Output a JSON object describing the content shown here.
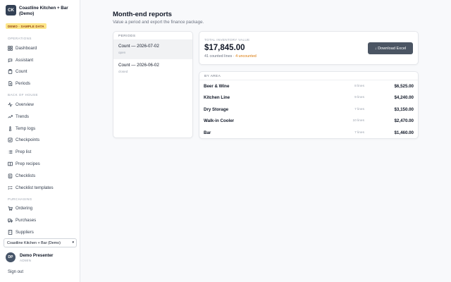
{
  "brand": {
    "logo": "CK",
    "name": "Coastline Kitchen + Bar (Demo)",
    "badge": "DEMO · SAMPLE DATA"
  },
  "nav": {
    "sections": [
      {
        "title": "OPERATIONS",
        "items": [
          {
            "label": "Dashboard",
            "icon": "dashboard-icon"
          },
          {
            "label": "Assistant",
            "icon": "chat-icon"
          },
          {
            "label": "Count",
            "icon": "clipboard-icon"
          },
          {
            "label": "Periods",
            "icon": "document-icon"
          }
        ]
      },
      {
        "title": "BACK OF HOUSE",
        "items": [
          {
            "label": "Overview",
            "icon": "activity-icon"
          },
          {
            "label": "Trends",
            "icon": "trend-icon"
          },
          {
            "label": "Temp logs",
            "icon": "thermometer-icon"
          },
          {
            "label": "Checkpoints",
            "icon": "check-square-icon"
          },
          {
            "label": "Prep list",
            "icon": "list-icon"
          },
          {
            "label": "Prep recipes",
            "icon": "book-icon"
          },
          {
            "label": "Checklists",
            "icon": "checklist-icon"
          },
          {
            "label": "Checklist templates",
            "icon": "template-icon"
          }
        ]
      },
      {
        "title": "PURCHASING",
        "items": [
          {
            "label": "Ordering",
            "icon": "cart-icon"
          },
          {
            "label": "Purchases",
            "icon": "truck-icon"
          },
          {
            "label": "Suppliers",
            "icon": "building-icon"
          }
        ]
      }
    ]
  },
  "org_select": {
    "value": "Coastline Kitchen + Bar (Demo)"
  },
  "user": {
    "initials": "DP",
    "name": "Demo Presenter",
    "role": "ADMIN"
  },
  "signout_label": "Sign out",
  "page": {
    "title": "Month-end reports",
    "subtitle": "Value a period and export the finance package."
  },
  "periods": {
    "header": "PERIODS",
    "items": [
      {
        "name": "Count — 2026-07-02",
        "status": "open",
        "active": true
      },
      {
        "name": "Count — 2026-06-02",
        "status": "closed",
        "active": false
      }
    ]
  },
  "summary": {
    "label": "TOTAL INVENTORY VALUE",
    "value": "$17,845.00",
    "counted": "41 counted lines",
    "separator": " · ",
    "uncounted": "4 uncounted",
    "download_label": "↓ Download Excel"
  },
  "areas": {
    "header": "BY AREA",
    "rows": [
      {
        "name": "Beer & Wine",
        "lines": "8 lines",
        "value": "$6,525.00"
      },
      {
        "name": "Kitchen Line",
        "lines": "9 lines",
        "value": "$4,240.00"
      },
      {
        "name": "Dry Storage",
        "lines": "7 lines",
        "value": "$3,150.00"
      },
      {
        "name": "Walk-in Cooler",
        "lines": "10 lines",
        "value": "$2,470.00"
      },
      {
        "name": "Bar",
        "lines": "7 lines",
        "value": "$1,460.00"
      }
    ]
  },
  "colors": {
    "accent": "#4b5563",
    "warning": "#d97706",
    "badge": "#fde68a"
  }
}
